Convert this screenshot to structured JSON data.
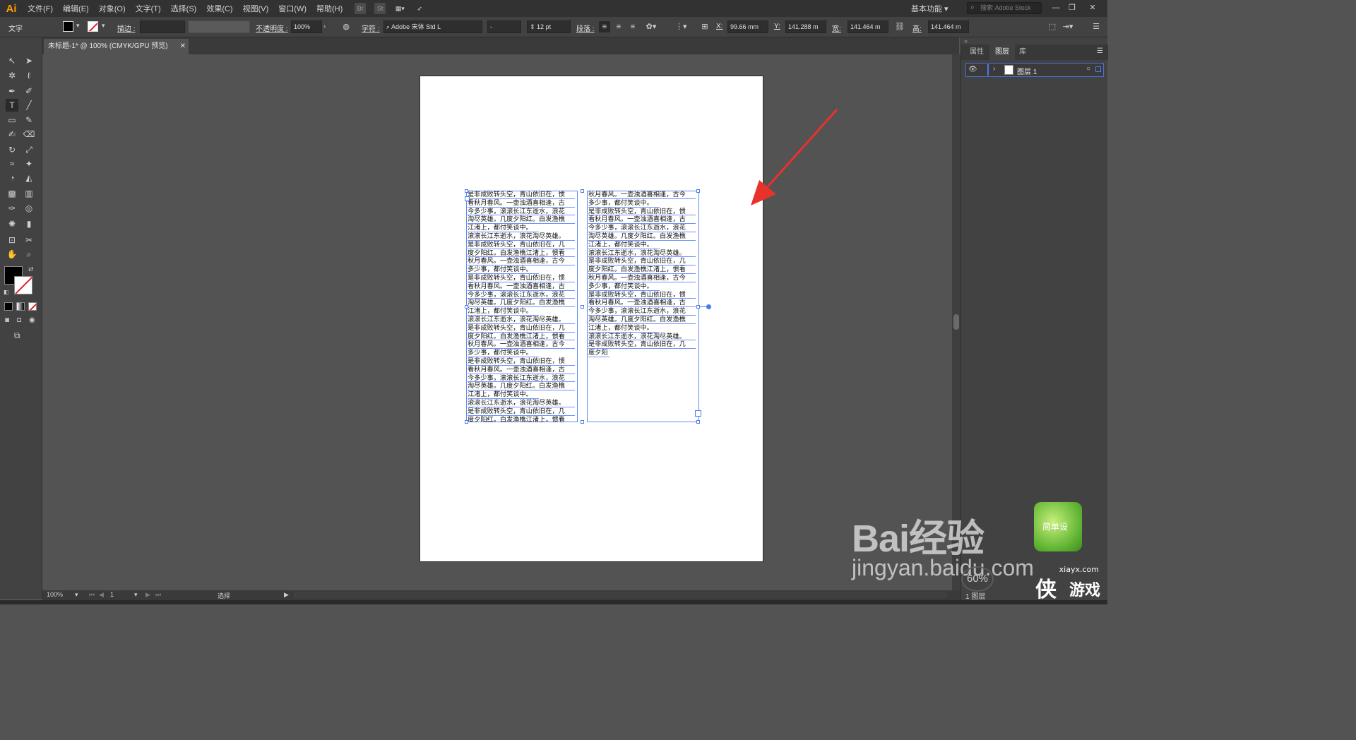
{
  "app": {
    "logo": "Ai",
    "menus": [
      "文件(F)",
      "编辑(E)",
      "对象(O)",
      "文字(T)",
      "选择(S)",
      "效果(C)",
      "视图(V)",
      "窗口(W)",
      "帮助(H)"
    ],
    "bridge_icons": [
      "Br",
      "St"
    ],
    "workspace": "基本功能",
    "stock_search_placeholder": "搜索 Adobe Stock",
    "win_min": "—",
    "win_restore": "❐",
    "win_close": "✕"
  },
  "control": {
    "tool_label": "文字",
    "stroke_label": "描边 :",
    "opacity_label": "不透明度 :",
    "opacity_value": "100%",
    "char_label": "字符 :",
    "font_name": "Adobe 宋体 Std L",
    "font_style": "-",
    "font_size": "12 pt",
    "para_label": "段落 :",
    "x_label": "X:",
    "x_value": "99.66 mm",
    "y_label": "Y:",
    "y_value": "141.288 m",
    "w_label": "宽:",
    "w_value": "141.464 m",
    "h_label": "高:",
    "h_value": "141.464 m"
  },
  "document": {
    "tab_title": "未标题-1* @ 100% (CMYK/GPU 预览)",
    "tab_close": "✕"
  },
  "text_columns": {
    "left_lines": [
      "是非成败转头空，青山依旧在，惯",
      "看秋月春风。一壶浊酒喜相逢，古",
      "今多少事，滚滚长江东逝水，浪花",
      "淘尽英雄。几度夕阳红。白发渔樵",
      "江渚上，都付笑谈中。",
      "滚滚长江东逝水，浪花淘尽英雄。",
      "是非成败转头空，青山依旧在，几",
      "度夕阳红。白发渔樵江渚上，惯看",
      "秋月春风。一壶浊酒喜相逢，古今",
      "多少事，都付笑谈中。",
      "是非成败转头空，青山依旧在，惯",
      "看秋月春风。一壶浊酒喜相逢，古",
      "今多少事，滚滚长江东逝水，浪花",
      "淘尽英雄。几度夕阳红。白发渔樵",
      "江渚上，都付笑谈中。",
      "滚滚长江东逝水，浪花淘尽英雄。",
      "是非成败转头空，青山依旧在，几",
      "度夕阳红。白发渔樵江渚上，惯看",
      "秋月春风。一壶浊酒喜相逢，古今",
      "多少事，都付笑谈中。",
      "是非成败转头空，青山依旧在，惯",
      "看秋月春风。一壶浊酒喜相逢，古",
      "今多少事，滚滚长江东逝水，浪花",
      "淘尽英雄。几度夕阳红。白发渔樵",
      "江渚上，都付笑谈中。",
      "滚滚长江东逝水，浪花淘尽英雄。",
      "是非成败转头空，青山依旧在，几",
      "度夕阳红。白发渔樵江渚上，惯看"
    ],
    "right_lines": [
      "秋月春风。一壶浊酒喜相逢，古今",
      "多少事，都付笑谈中。",
      "是非成败转头空，青山依旧在，惯",
      "看秋月春风。一壶浊酒喜相逢，古",
      "今多少事，滚滚长江东逝水，浪花",
      "淘尽英雄。几度夕阳红。白发渔樵",
      "江渚上，都付笑谈中。",
      "滚滚长江东逝水，浪花淘尽英雄。",
      "是非成败转头空，青山依旧在，几",
      "度夕阳红。白发渔樵江渚上，惯看",
      "秋月春风。一壶浊酒喜相逢，古今",
      "多少事，都付笑谈中。",
      "是非成败转头空，青山依旧在，惯",
      "看秋月春风。一壶浊酒喜相逢，古",
      "今多少事，滚滚长江东逝水，浪花",
      "淘尽英雄。几度夕阳红。白发渔樵",
      "江渚上，都付笑谈中。",
      "滚滚长江东逝水，浪花淘尽英雄。",
      "是非成败转头空，青山依旧在，几",
      "度夕阳"
    ]
  },
  "status": {
    "zoom": "100%",
    "page": "1",
    "tool_name": "选择"
  },
  "right_panel": {
    "tabs": [
      "属性",
      "图层",
      "库"
    ],
    "active_tab": "图层",
    "layer_name": "图层 1",
    "bottom_label": "1 图层"
  },
  "watermark": {
    "brand": "Bai经验",
    "url": "jingyan.baidu.com",
    "badge_text": "简单设",
    "percent": "60%",
    "site": "xiayx.com",
    "site_text_1": "侠",
    "site_text_2": "游戏"
  },
  "colors": {
    "accent_orange": "#ff9a00",
    "selection_blue": "#5b8cf0",
    "arrow_red": "#e8322b"
  }
}
